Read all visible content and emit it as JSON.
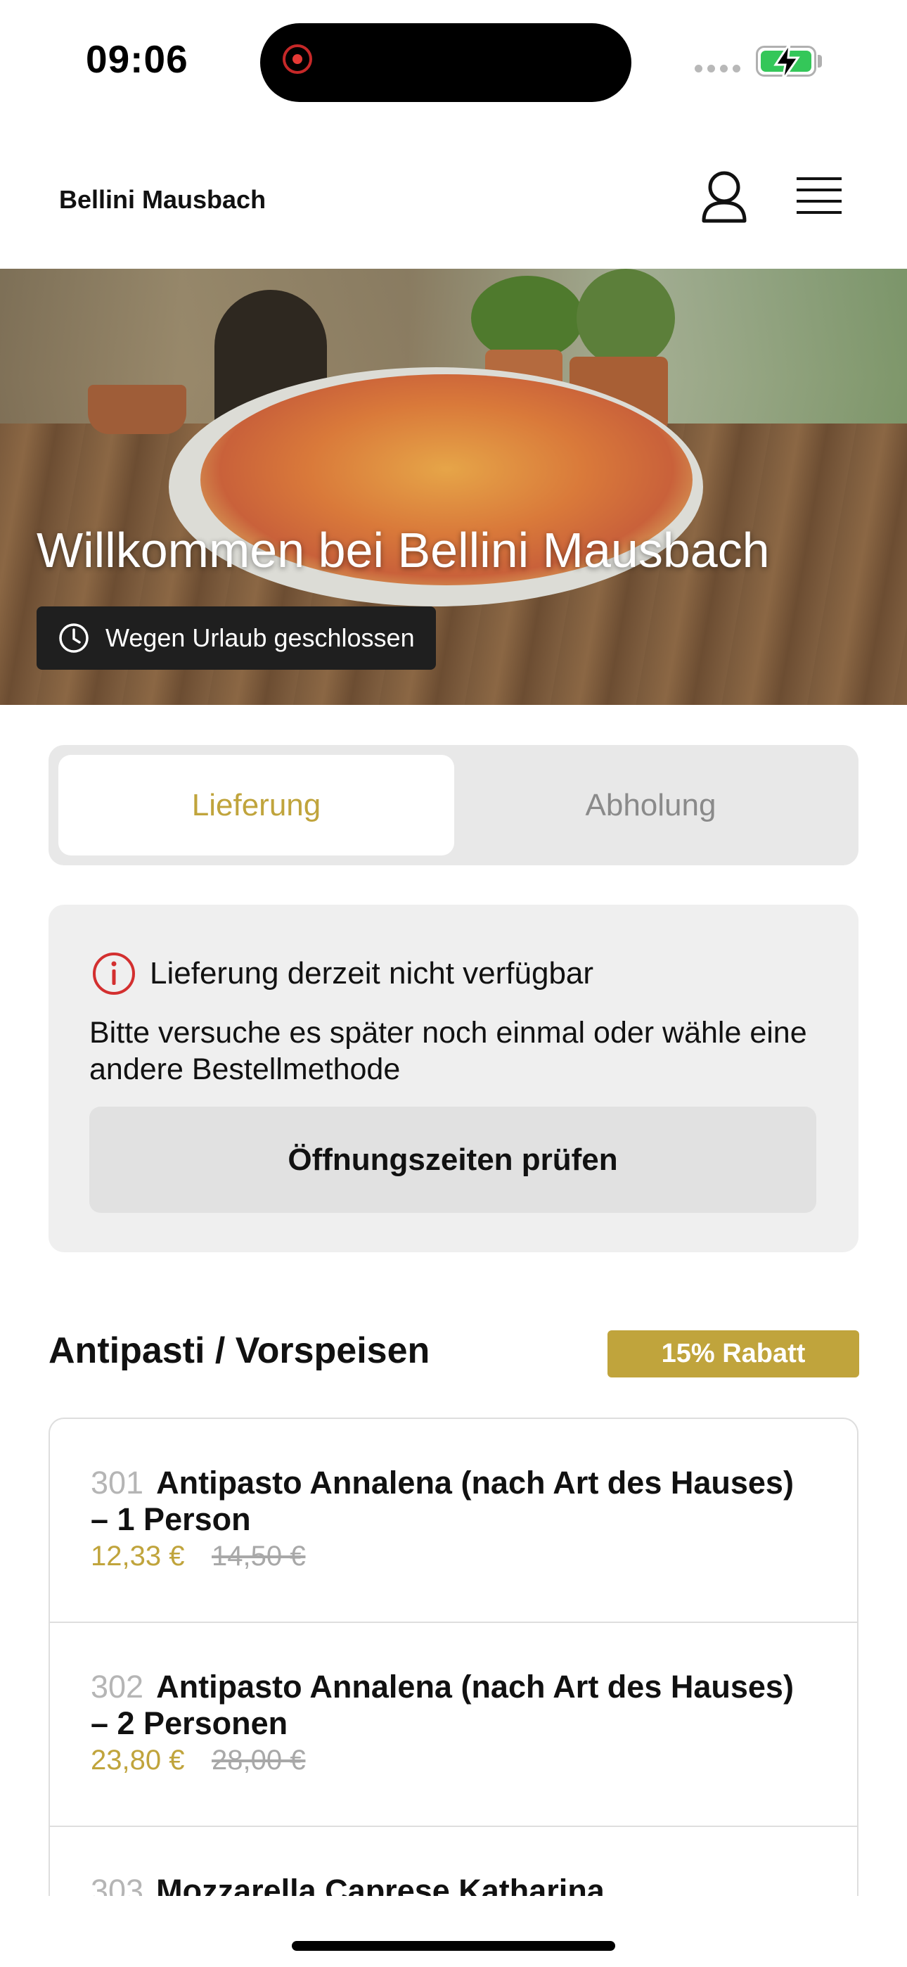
{
  "status_bar": {
    "time": "09:06"
  },
  "header": {
    "brand": "Bellini Mausbach"
  },
  "hero": {
    "title": "Willkommen bei Bellini Mausbach",
    "status": "Wegen Urlaub geschlossen"
  },
  "tabs": [
    {
      "label": "Lieferung",
      "active": true
    },
    {
      "label": "Abholung",
      "active": false
    }
  ],
  "notice": {
    "title": "Lieferung derzeit nicht verfügbar",
    "body": "Bitte versuche es später noch einmal oder wähle eine andere Bestellmethode",
    "button": "Öffnungszeiten prüfen"
  },
  "section": {
    "title": "Antipasti / Vorspeisen",
    "badge": "15% Rabatt"
  },
  "items": [
    {
      "num": "301",
      "name": "Antipasto Annalena (nach Art des Hauses) – 1 Person",
      "price": "12,33 €",
      "old_price": "14,50 €"
    },
    {
      "num": "302",
      "name": "Antipasto Annalena (nach Art des Hauses) – 2 Personen",
      "price": "23,80 €",
      "old_price": "28,00 €"
    },
    {
      "num": "303",
      "name": "Mozzarella Caprese Katharina",
      "price": "",
      "old_price": ""
    }
  ],
  "colors": {
    "accent": "#c0a43c",
    "alert": "#d32f2f"
  }
}
